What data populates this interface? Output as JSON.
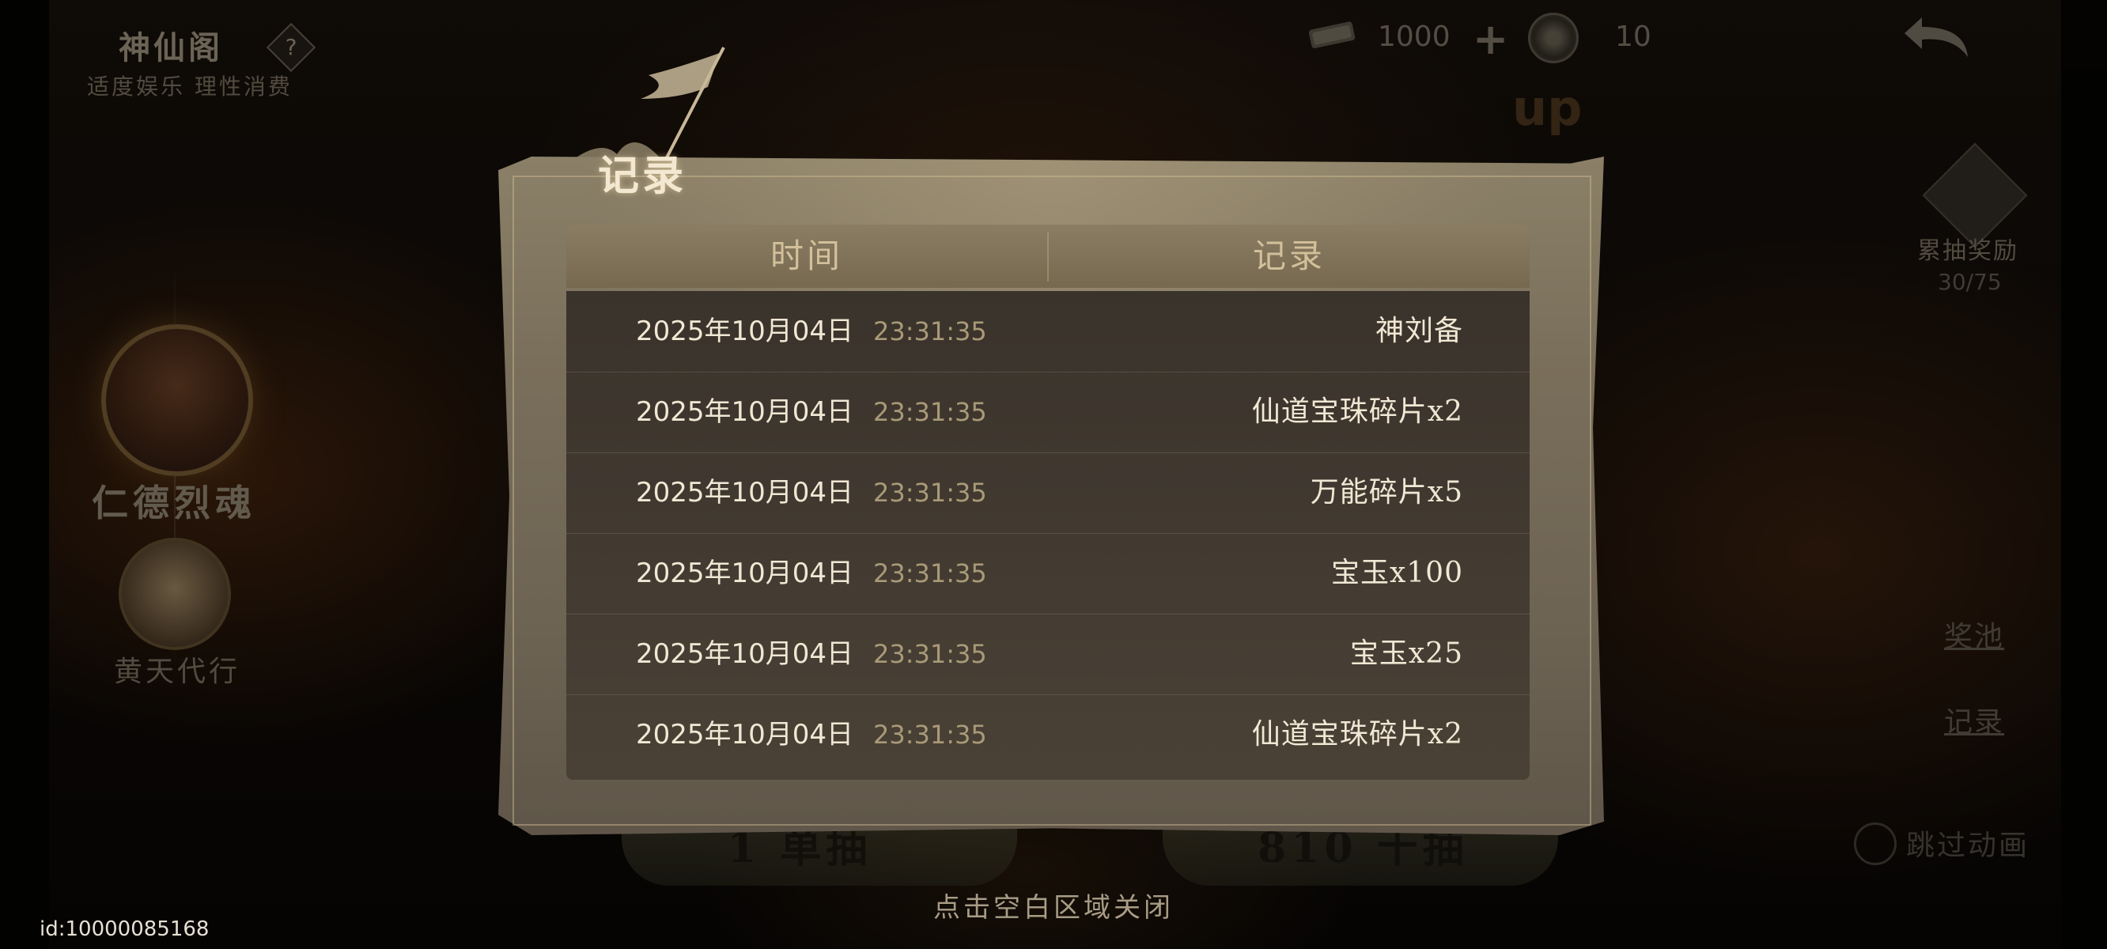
{
  "header": {
    "title": "神仙阁",
    "help": "?",
    "subtitle": "适度娱乐 理性消费",
    "currency_a": "1000",
    "plus": "+",
    "currency_b": "10"
  },
  "left_panel": {
    "hero_1": "仁德烈魂",
    "hero_2": "黄天代行"
  },
  "right_panel": {
    "cumulative_label": "累抽奖励",
    "cumulative_progress": "30/75",
    "pool_link": "奖池",
    "record_link": "记录",
    "skip_label": "跳过动画"
  },
  "banner_up": "up",
  "bottom": {
    "single_draw": "1 单抽",
    "ten_draw": "810 十抽",
    "close_hint": "点击空白区域关闭",
    "user_id": "id:10000085168"
  },
  "modal": {
    "title": "记录",
    "col_time": "时间",
    "col_record": "记录",
    "rows": [
      {
        "date": "2025年10月04日",
        "time": "23:31:35",
        "record": "神刘备"
      },
      {
        "date": "2025年10月04日",
        "time": "23:31:35",
        "record": "仙道宝珠碎片x2"
      },
      {
        "date": "2025年10月04日",
        "time": "23:31:35",
        "record": "万能碎片x5"
      },
      {
        "date": "2025年10月04日",
        "time": "23:31:35",
        "record": "宝玉x100"
      },
      {
        "date": "2025年10月04日",
        "time": "23:31:35",
        "record": "宝玉x25"
      },
      {
        "date": "2025年10月04日",
        "time": "23:31:35",
        "record": "仙道宝珠碎片x2"
      }
    ]
  },
  "colors": {
    "modal_bg": "#7a6f5b",
    "table_header_text": "#d2c09a",
    "time_text": "#a99a78",
    "record_text": "#f1e7d4"
  }
}
